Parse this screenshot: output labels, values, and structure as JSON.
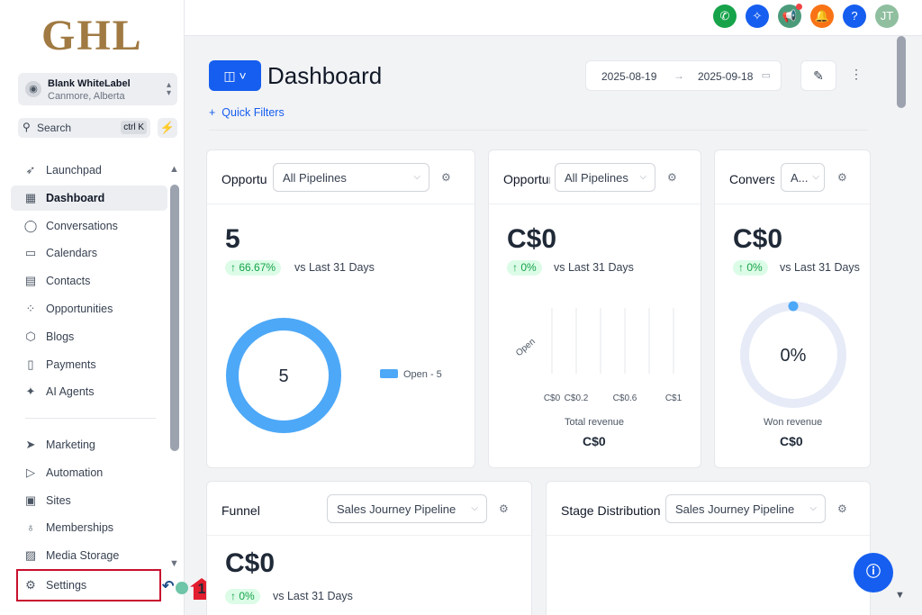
{
  "brand": {
    "logo_text": "GHL"
  },
  "account": {
    "name": "Blank WhiteLabel",
    "location": "Canmore, Alberta"
  },
  "search": {
    "label": "Search",
    "shortcut": "ctrl K"
  },
  "sidebar": {
    "items": [
      {
        "label": "Launchpad",
        "icon": "rocket-icon",
        "glyph": "➶"
      },
      {
        "label": "Dashboard",
        "icon": "grid-icon",
        "glyph": "▦"
      },
      {
        "label": "Conversations",
        "icon": "chat-bubble-icon",
        "glyph": "◯"
      },
      {
        "label": "Calendars",
        "icon": "calendar-icon",
        "glyph": "▭"
      },
      {
        "label": "Contacts",
        "icon": "contacts-icon",
        "glyph": "▤"
      },
      {
        "label": "Opportunities",
        "icon": "pipeline-icon",
        "glyph": "⁘"
      },
      {
        "label": "Blogs",
        "icon": "cube-icon",
        "glyph": "⬡"
      },
      {
        "label": "Payments",
        "icon": "receipt-icon",
        "glyph": "▯"
      },
      {
        "label": "AI Agents",
        "icon": "sparkle-icon",
        "glyph": "✦"
      }
    ],
    "items2": [
      {
        "label": "Marketing",
        "icon": "send-icon",
        "glyph": "➤"
      },
      {
        "label": "Automation",
        "icon": "play-circle-icon",
        "glyph": "▷"
      },
      {
        "label": "Sites",
        "icon": "browser-icon",
        "glyph": "▣"
      },
      {
        "label": "Memberships",
        "icon": "award-icon",
        "glyph": "♁"
      },
      {
        "label": "Media Storage",
        "icon": "image-icon",
        "glyph": "▨"
      }
    ],
    "settings": {
      "label": "Settings",
      "icon": "gear-icon",
      "glyph": "⚙"
    }
  },
  "annotation": {
    "step_number": "1"
  },
  "topbar": {
    "icons": [
      {
        "name": "phone-icon",
        "glyph": "✆",
        "color": "#16a34a"
      },
      {
        "name": "magic-icon",
        "glyph": "✧",
        "color": "#155eef"
      },
      {
        "name": "megaphone-icon",
        "glyph": "📢",
        "color": "#4b9b7b"
      },
      {
        "name": "bell-icon",
        "glyph": "🔔",
        "color": "#f97316"
      },
      {
        "name": "help-icon",
        "glyph": "?",
        "color": "#155eef"
      }
    ],
    "avatar_initials": "JT",
    "avatar_color": "#8fbf9f"
  },
  "header": {
    "title": "Dashboard",
    "quick_filters": "Quick Filters"
  },
  "date_range": {
    "start": "2025-08-19",
    "end": "2025-09-18"
  },
  "cards": {
    "opp_count": {
      "title": "Opportunities",
      "select": "All Pipelines",
      "value": "5",
      "change": "↑ 66.67%",
      "vs": "vs Last 31 Days",
      "donut_center": "5",
      "legend": "Open - 5"
    },
    "opp_value": {
      "title": "Opportunities",
      "select": "All Pipelines",
      "value": "C$0",
      "change": "↑ 0%",
      "vs": "vs Last 31 Days",
      "caption": "Total revenue",
      "caption_value": "C$0"
    },
    "conversion": {
      "title": "Conversion",
      "select": "A...",
      "value": "C$0",
      "change": "↑ 0%",
      "vs": "vs Last 31 Days",
      "gauge_center": "0%",
      "caption": "Won revenue",
      "caption_value": "C$0"
    },
    "funnel": {
      "title": "Funnel",
      "select": "Sales Journey Pipeline",
      "value": "C$0",
      "change": "↑ 0%",
      "vs": "vs Last 31 Days"
    },
    "stage": {
      "title": "Stage Distribution",
      "select": "Sales Journey Pipeline"
    }
  },
  "chart_data": [
    {
      "type": "pie",
      "categories": [
        "Open"
      ],
      "values": [
        5
      ],
      "legend_labels": [
        "Open - 5"
      ]
    },
    {
      "type": "bar",
      "categories": [
        "Open"
      ],
      "values": [
        0
      ],
      "xlabel": "Total revenue",
      "x_ticks": [
        "C$0",
        "C$0.2",
        "C$0.6",
        "C$1"
      ],
      "xlim": [
        0,
        1
      ]
    }
  ]
}
